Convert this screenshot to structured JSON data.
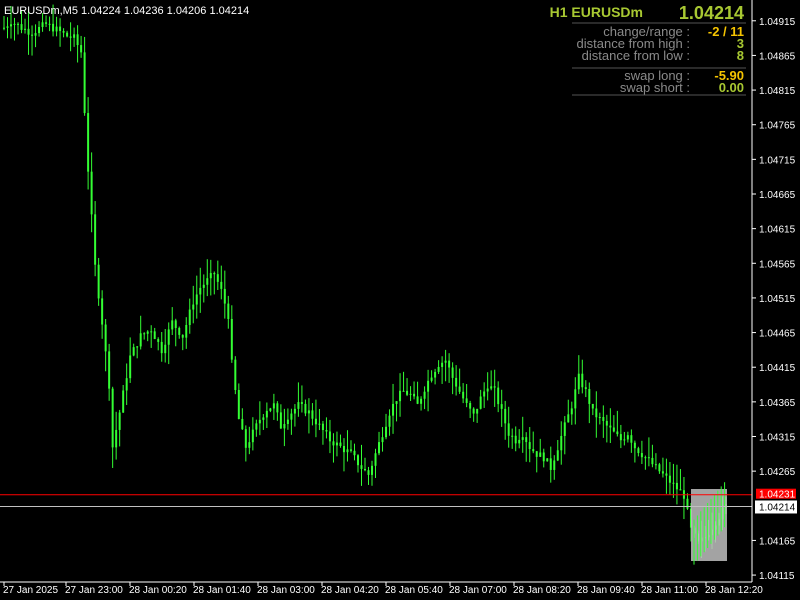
{
  "window": {
    "title": "EURUSDm,M5  1.04224 1.04236 1.04206 1.04214"
  },
  "panel": {
    "symbol": "H1 EURUSDm",
    "price": "1.04214",
    "rows": [
      {
        "label": "change/range :",
        "value": "-2 / 11",
        "color": "#f5c400"
      },
      {
        "label": "distance from high :",
        "value": "3",
        "color": "#a8c832"
      },
      {
        "label": "distance from low :",
        "value": "8",
        "color": "#a8c832"
      },
      {
        "label": "swap long :",
        "value": "-5.90",
        "color": "#f5c400"
      },
      {
        "label": "swap short :",
        "value": "0.00",
        "color": "#a8c832"
      }
    ]
  },
  "price_scale": {
    "ticks": [
      "1.04915",
      "1.04865",
      "1.04815",
      "1.04765",
      "1.04715",
      "1.04665",
      "1.04615",
      "1.04565",
      "1.04515",
      "1.04465",
      "1.04415",
      "1.04365",
      "1.04315",
      "1.04265",
      "1.04165",
      "1.04115"
    ],
    "red_line_label": "1.04231",
    "current_label": "1.04214"
  },
  "time_scale": {
    "ticks": [
      "27 Jan 2025",
      "27 Jan 23:00",
      "28 Jan 00:20",
      "28 Jan 01:40",
      "28 Jan 03:00",
      "28 Jan 04:20",
      "28 Jan 05:40",
      "28 Jan 07:00",
      "28 Jan 08:20",
      "28 Jan 09:40",
      "28 Jan 11:00",
      "28 Jan 12:20"
    ]
  },
  "colors": {
    "background": "#000000",
    "candle": "#33ff33",
    "red_line": "#ff0000",
    "bid_line": "#c0c0c0",
    "panel_title": "#a8c832",
    "panel_price": "#a8c832",
    "box": "#c0c0c0"
  },
  "chart_data": {
    "type": "line",
    "title": "EURUSDm,M5",
    "ylim": [
      1.04105,
      1.04945
    ],
    "red_line": 1.04231,
    "bid": 1.04214,
    "close_path": [
      [
        0,
        1.04905
      ],
      [
        2,
        1.04915
      ],
      [
        5,
        1.04905
      ],
      [
        8,
        1.04898
      ],
      [
        12,
        1.0491
      ],
      [
        15,
        1.04902
      ],
      [
        18,
        1.04893
      ],
      [
        20,
        1.0489
      ],
      [
        22,
        1.0487
      ],
      [
        24,
        1.047
      ],
      [
        26,
        1.0456
      ],
      [
        28,
        1.0448
      ],
      [
        30,
        1.0439
      ],
      [
        31,
        1.043
      ],
      [
        33,
        1.0435
      ],
      [
        36,
        1.0443
      ],
      [
        39,
        1.0446
      ],
      [
        42,
        1.0447
      ],
      [
        45,
        1.0444
      ],
      [
        48,
        1.0448
      ],
      [
        51,
        1.0446
      ],
      [
        54,
        1.0451
      ],
      [
        56,
        1.0453
      ],
      [
        58,
        1.0454
      ],
      [
        60,
        1.0455
      ],
      [
        62,
        1.04525
      ],
      [
        64,
        1.0449
      ],
      [
        65,
        1.0442
      ],
      [
        67,
        1.0434
      ],
      [
        69,
        1.043
      ],
      [
        71,
        1.0432
      ],
      [
        73,
        1.0434
      ],
      [
        75,
        1.04355
      ],
      [
        77,
        1.0436
      ],
      [
        79,
        1.0433
      ],
      [
        81,
        1.04345
      ],
      [
        84,
        1.0436
      ],
      [
        87,
        1.0435
      ],
      [
        90,
        1.0433
      ],
      [
        93,
        1.0431
      ],
      [
        96,
        1.043
      ],
      [
        99,
        1.0429
      ],
      [
        102,
        1.0427
      ],
      [
        104,
        1.0426
      ],
      [
        106,
        1.0429
      ],
      [
        108,
        1.0432
      ],
      [
        110,
        1.0435
      ],
      [
        112,
        1.0437
      ],
      [
        114,
        1.0438
      ],
      [
        116,
        1.04375
      ],
      [
        118,
        1.0436
      ],
      [
        120,
        1.04385
      ],
      [
        122,
        1.04405
      ],
      [
        124,
        1.0442
      ],
      [
        126,
        1.04425
      ],
      [
        128,
        1.044
      ],
      [
        130,
        1.0438
      ],
      [
        132,
        1.0436
      ],
      [
        134,
        1.04345
      ],
      [
        136,
        1.0437
      ],
      [
        138,
        1.0439
      ],
      [
        140,
        1.0438
      ],
      [
        142,
        1.0435
      ],
      [
        144,
        1.0432
      ],
      [
        146,
        1.0431
      ],
      [
        148,
        1.0432
      ],
      [
        150,
        1.043
      ],
      [
        152,
        1.0429
      ],
      [
        154,
        1.04285
      ],
      [
        156,
        1.0427
      ],
      [
        158,
        1.043
      ],
      [
        160,
        1.0433
      ],
      [
        162,
        1.0436
      ],
      [
        164,
        1.044
      ],
      [
        166,
        1.0438
      ],
      [
        168,
        1.0435
      ],
      [
        170,
        1.0434
      ],
      [
        172,
        1.0433
      ],
      [
        174,
        1.0432
      ],
      [
        176,
        1.0431
      ],
      [
        178,
        1.0432
      ],
      [
        180,
        1.043
      ],
      [
        182,
        1.0429
      ],
      [
        184,
        1.0428
      ],
      [
        186,
        1.0427
      ],
      [
        188,
        1.0426
      ],
      [
        190,
        1.0425
      ],
      [
        192,
        1.0424
      ],
      [
        194,
        1.0423
      ],
      [
        196,
        1.0418
      ],
      [
        198,
        1.0416
      ],
      [
        200,
        1.0417
      ],
      [
        202,
        1.04185
      ],
      [
        204,
        1.042
      ],
      [
        206,
        1.04214
      ]
    ]
  }
}
